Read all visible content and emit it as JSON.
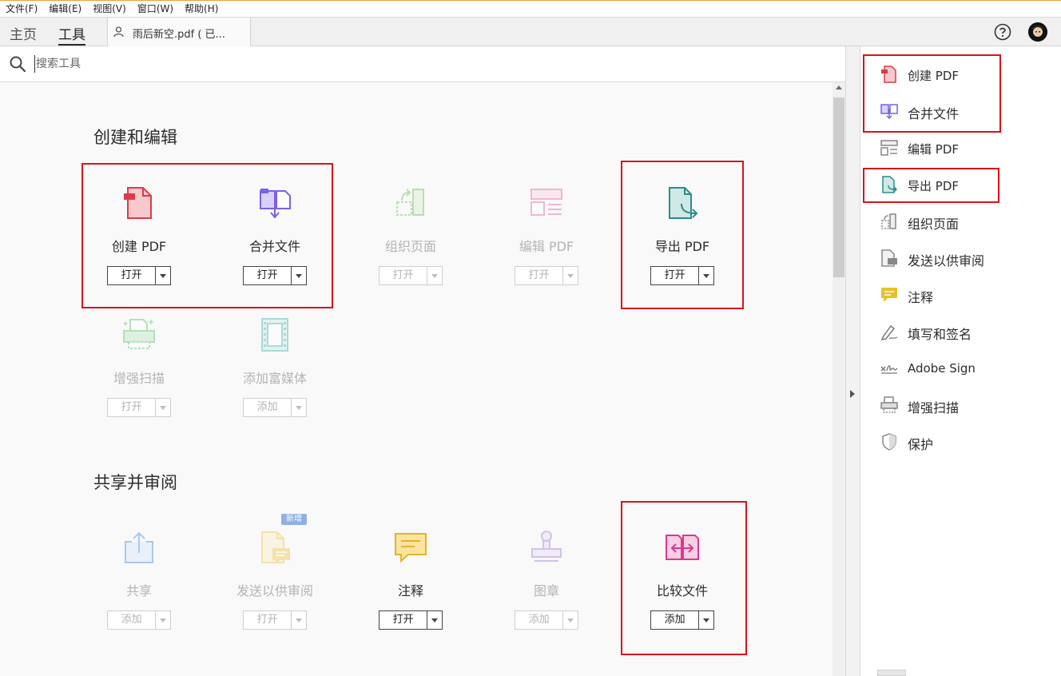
{
  "menu": [
    "文件(F)",
    "编辑(E)",
    "视图(V)",
    "窗口(W)",
    "帮助(H)"
  ],
  "tabs": {
    "home": "主页",
    "tools": "工具",
    "document": "雨后新空.pdf ( 已..."
  },
  "search": {
    "placeholder": "搜索工具"
  },
  "sections": {
    "create_edit": "创建和编辑",
    "share_review": "共享并审阅"
  },
  "tools": [
    {
      "name": "创建 PDF",
      "button": "打开",
      "enabled": true,
      "icon": "create-pdf-icon",
      "color": "#dc3b4a"
    },
    {
      "name": "合并文件",
      "button": "打开",
      "enabled": true,
      "icon": "combine-files-icon",
      "color": "#7b61e8"
    },
    {
      "name": "组织页面",
      "button": "打开",
      "enabled": false,
      "icon": "organize-pages-icon",
      "color": "#8bd07a"
    },
    {
      "name": "编辑 PDF",
      "button": "打开",
      "enabled": false,
      "icon": "edit-pdf-icon",
      "color": "#e36b9f"
    },
    {
      "name": "导出 PDF",
      "button": "打开",
      "enabled": true,
      "icon": "export-pdf-icon",
      "color": "#2a8d8a"
    },
    {
      "name": "增强扫描",
      "button": "打开",
      "enabled": false,
      "icon": "enhance-scan-icon",
      "color": "#5ec46a"
    },
    {
      "name": "添加富媒体",
      "button": "添加",
      "enabled": false,
      "icon": "rich-media-icon",
      "color": "#4fb3ae"
    },
    {
      "name": "共享",
      "button": "添加",
      "enabled": false,
      "icon": "share-icon",
      "color": "#4a90e2"
    },
    {
      "name": "发送以供审阅",
      "button": "打开",
      "enabled": false,
      "icon": "send-review-icon",
      "color": "#f0c64a"
    },
    {
      "name": "注释",
      "button": "打开",
      "enabled": true,
      "icon": "comment-icon",
      "color": "#e0b52a"
    },
    {
      "name": "图章",
      "button": "添加",
      "enabled": false,
      "icon": "stamp-icon",
      "color": "#a57fd8"
    },
    {
      "name": "比较文件",
      "button": "添加",
      "enabled": true,
      "icon": "compare-files-icon",
      "color": "#d93891"
    }
  ],
  "new_badge": "新增",
  "right_panel": [
    {
      "label": "创建 PDF",
      "icon": "create-pdf-icon"
    },
    {
      "label": "合并文件",
      "icon": "combine-files-icon"
    },
    {
      "label": "编辑 PDF",
      "icon": "edit-pdf-icon"
    },
    {
      "label": "导出 PDF",
      "icon": "export-pdf-icon"
    },
    {
      "label": "组织页面",
      "icon": "organize-pages-icon"
    },
    {
      "label": "发送以供审阅",
      "icon": "send-review-icon"
    },
    {
      "label": "注释",
      "icon": "comment-icon"
    },
    {
      "label": "填写和签名",
      "icon": "fill-sign-icon"
    },
    {
      "label": "Adobe Sign",
      "icon": "adobe-sign-icon"
    },
    {
      "label": "增强扫描",
      "icon": "enhance-scan-icon"
    },
    {
      "label": "保护",
      "icon": "protect-icon"
    }
  ]
}
